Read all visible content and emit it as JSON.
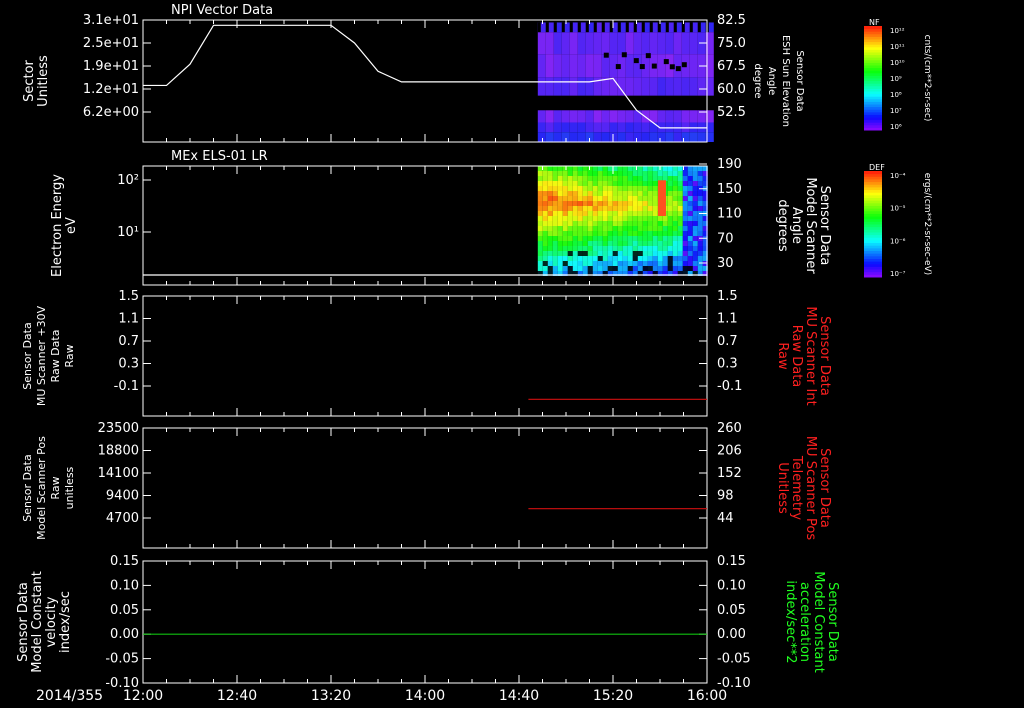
{
  "footer": {
    "date": "2014/355",
    "time_ticks": [
      "12:00",
      "12:40",
      "13:20",
      "14:00",
      "14:40",
      "15:20",
      "16:00"
    ]
  },
  "chart_data": [
    {
      "type": "heatmap",
      "title": "NPI Vector Data",
      "ylabel_left": [
        "Sector",
        "Unitless"
      ],
      "yticks_left": [
        "3.1e+01",
        "2.5e+01",
        "1.9e+01",
        "1.2e+01",
        "6.2e+00"
      ],
      "ylabel_right": [
        "Sensor Data",
        "ESH Sun Elevation",
        "Angle",
        "degree"
      ],
      "yticks_right": [
        "82.5",
        "75.0",
        "67.5",
        "60.0",
        "52.5"
      ],
      "colorbar": {
        "label": "NF",
        "unit": "cnts/(cm**2-sr-sec)",
        "ticks": [
          "10¹²",
          "10¹¹",
          "10¹⁰",
          "10⁹",
          "10⁸",
          "10⁷",
          "10⁶"
        ]
      },
      "data_start": "14:48",
      "overlay_line": {
        "color": "#ffffff",
        "x": [
          "12:00",
          "12:10",
          "12:20",
          "12:30",
          "13:20",
          "13:30",
          "13:40",
          "13:50",
          "15:00",
          "15:10",
          "15:20",
          "15:30",
          "15:40",
          "16:00"
        ],
        "y": [
          64,
          64,
          70,
          81,
          81,
          76,
          68,
          65,
          65,
          65,
          66,
          57,
          52,
          52
        ]
      }
    },
    {
      "type": "heatmap",
      "title": "MEx ELS-01 LR",
      "ylabel_left": [
        "Electron Energy",
        "eV"
      ],
      "yticks_left": [
        "10²",
        "10¹"
      ],
      "ylabel_right": [
        "Sensor Data",
        "Model Scanner",
        "Angle",
        "degrees"
      ],
      "yticks_right": [
        "190",
        "150",
        "110",
        "70",
        "30"
      ],
      "colorbar": {
        "label": "DEF",
        "unit": "ergs/(cm**2-sr-sec-eV)",
        "ticks": [
          "10⁻⁴",
          "10⁻⁵",
          "10⁻⁶",
          "10⁻⁷"
        ]
      },
      "data_start": "14:48",
      "overlay_line": {
        "color": "#ffffff",
        "x": [
          "12:00",
          "16:00"
        ],
        "y": [
          2,
          2
        ]
      }
    },
    {
      "type": "line",
      "ylabel_left": [
        "Sensor Data",
        "MU Scanner +30V",
        "Raw Data",
        "Raw"
      ],
      "yticks_left": [
        "1.5",
        "1.1",
        "0.7",
        "0.3",
        "-0.1"
      ],
      "ylabel_right": [
        "Sensor Data",
        "MU Scanner Int",
        "Raw Data",
        "Raw"
      ],
      "yticks_right": [
        "1.5",
        "1.1",
        "0.7",
        "0.3",
        "-0.1"
      ],
      "ylim": [
        -0.3,
        1.5
      ],
      "right_label_color": "#ff2020",
      "series": [
        {
          "color": "#d01010",
          "x": [
            "14:44",
            "16:00"
          ],
          "y": [
            -0.05,
            -0.05
          ]
        }
      ]
    },
    {
      "type": "line",
      "ylabel_left": [
        "Sensor Data",
        "Model Scanner Pos",
        "Raw",
        "unitless"
      ],
      "yticks_left": [
        "23500",
        "18800",
        "14100",
        "9400",
        "4700"
      ],
      "ylabel_right": [
        "Sensor Data",
        "MU Scanner Pos",
        "Telemetry",
        "Unitless"
      ],
      "yticks_right": [
        "260",
        "206",
        "152",
        "98",
        "44"
      ],
      "ylim": [
        0,
        23500
      ],
      "right_label_color": "#ff2020",
      "series": [
        {
          "color": "#d01010",
          "x": [
            "14:44",
            "16:00"
          ],
          "y": [
            7700,
            7700
          ]
        }
      ]
    },
    {
      "type": "line",
      "ylabel_left": [
        "Sensor Data",
        "Model Constant",
        "velocity",
        "index/sec"
      ],
      "yticks_left": [
        "0.15",
        "0.10",
        "0.05",
        "0.00",
        "-0.05",
        "-0.10"
      ],
      "ylabel_right": [
        "Sensor Data",
        "Model Constant",
        "acceleration",
        "index/sec**2"
      ],
      "yticks_right": [
        "0.15",
        "0.10",
        "0.05",
        "0.00",
        "-0.05",
        "-0.10"
      ],
      "ylim": [
        -0.1,
        0.15
      ],
      "right_label_color": "#20ff20",
      "series": [
        {
          "color": "#10c010",
          "x": [
            "12:00",
            "16:00"
          ],
          "y": [
            0.0,
            0.0
          ]
        }
      ]
    }
  ]
}
